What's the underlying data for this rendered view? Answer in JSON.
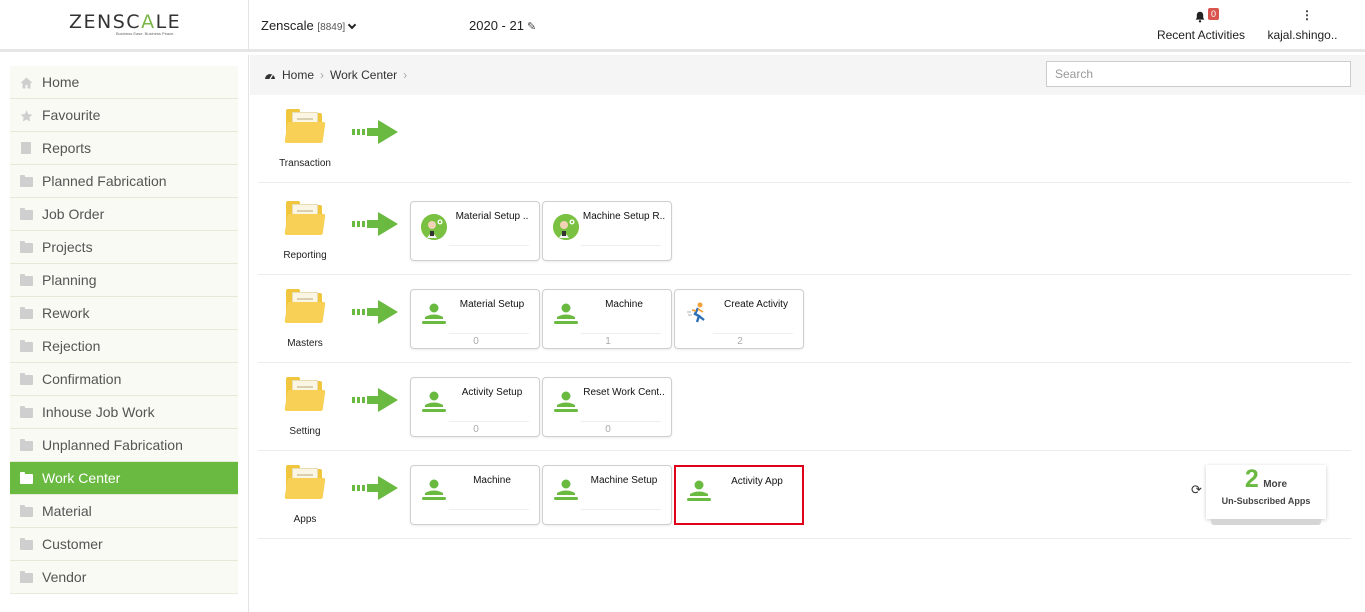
{
  "header": {
    "logo_text_a": "ZENSC",
    "logo_text_b": "A",
    "logo_text_c": "LE",
    "logo_tagline": "Business Ease. Business Peace.",
    "company_name": "Zenscale",
    "company_id": "[8849]",
    "fiscal_year": "2020 - 21",
    "notifications_label": "Recent Activities",
    "notifications_count": "0",
    "user_name": "kajal.shingo..",
    "accent_color": "#6aba42"
  },
  "sidebar": {
    "items": [
      {
        "label": "Home",
        "icon": "home-icon"
      },
      {
        "label": "Favourite",
        "icon": "star-icon"
      },
      {
        "label": "Reports",
        "icon": "document-icon"
      },
      {
        "label": "Planned Fabrication",
        "icon": "folder-icon"
      },
      {
        "label": "Job Order",
        "icon": "folder-icon"
      },
      {
        "label": "Projects",
        "icon": "folder-icon"
      },
      {
        "label": "Planning",
        "icon": "folder-icon"
      },
      {
        "label": "Rework",
        "icon": "folder-icon"
      },
      {
        "label": "Rejection",
        "icon": "folder-icon"
      },
      {
        "label": "Confirmation",
        "icon": "folder-icon"
      },
      {
        "label": "Inhouse Job Work",
        "icon": "folder-icon"
      },
      {
        "label": "Unplanned Fabrication",
        "icon": "folder-icon"
      },
      {
        "label": "Work Center",
        "icon": "folder-icon",
        "active": true
      },
      {
        "label": "Material",
        "icon": "folder-icon"
      },
      {
        "label": "Customer",
        "icon": "folder-icon"
      },
      {
        "label": "Vendor",
        "icon": "folder-icon"
      }
    ]
  },
  "breadcrumb": {
    "home": "Home",
    "current": "Work Center",
    "search_placeholder": "Search"
  },
  "rows": [
    {
      "label": "Transaction",
      "tiles": []
    },
    {
      "label": "Reporting",
      "tiles": [
        {
          "title": "Material Setup ..",
          "count": "",
          "icon": "report-avatar-icon"
        },
        {
          "title": "Machine Setup R..",
          "count": "",
          "icon": "report-avatar-icon"
        }
      ]
    },
    {
      "label": "Masters",
      "tiles": [
        {
          "title": "Material Setup",
          "count": "0",
          "icon": "person-icon"
        },
        {
          "title": "Machine",
          "count": "1",
          "icon": "person-icon"
        },
        {
          "title": "Create Activity",
          "count": "2",
          "icon": "runner-icon"
        }
      ]
    },
    {
      "label": "Setting",
      "tiles": [
        {
          "title": "Activity Setup",
          "count": "0",
          "icon": "person-icon"
        },
        {
          "title": "Reset Work Cent..",
          "count": "0",
          "icon": "person-icon"
        }
      ]
    },
    {
      "label": "Apps",
      "tiles": [
        {
          "title": "Machine",
          "count": "",
          "icon": "person-icon"
        },
        {
          "title": "Machine Setup",
          "count": "",
          "icon": "person-icon"
        },
        {
          "title": "Activity App",
          "count": "",
          "icon": "person-icon",
          "highlighted": true
        }
      ]
    }
  ],
  "more_apps": {
    "count": "2",
    "more_label": "More",
    "sub_label": "Un-Subscribed Apps"
  }
}
